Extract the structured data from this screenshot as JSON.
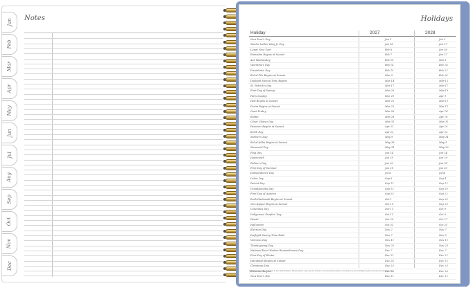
{
  "notes_page": {
    "title": "Notes",
    "month_tabs": [
      "Jan",
      "Feb",
      "Mar",
      "Apr",
      "May",
      "Jun",
      "Jul",
      "Aug",
      "Sep",
      "Oct",
      "Nov",
      "Dec"
    ]
  },
  "holidays_page": {
    "title": "Holidays",
    "columns": [
      "Holiday",
      "2027",
      "2028"
    ],
    "rows": [
      [
        "New Year's Day",
        "Jan 1",
        "Jan 1"
      ],
      [
        "Martin Luther King Jr. Day",
        "Jan 18",
        "Jan 17"
      ],
      [
        "Lunar New Year",
        "Feb 6",
        "Jan 26"
      ],
      [
        "Ramadan Begins at Sunset",
        "Feb 7",
        "Jan 27"
      ],
      [
        "Ash Wednesday",
        "Feb 10",
        "Mar 1"
      ],
      [
        "Valentine's Day",
        "Feb 14",
        "Feb 14"
      ],
      [
        "Presidents' Day",
        "Feb 15",
        "Feb 21"
      ],
      [
        "Eid al-Fitr Begins at Sunset",
        "Mar 9",
        "Feb 26"
      ],
      [
        "Daylight Saving Time Begins",
        "Mar 14",
        "Mar 12"
      ],
      [
        "St. Patrick's Day",
        "Mar 17",
        "Mar 17"
      ],
      [
        "First Day of Spring",
        "Mar 20",
        "Mar 19"
      ],
      [
        "Palm Sunday",
        "Mar 21",
        "Apr 9"
      ],
      [
        "Holi Begins at Sunset",
        "Mar 22",
        "Mar 11"
      ],
      [
        "Purim Begins at Sunset",
        "Mar 22",
        "Mar 11"
      ],
      [
        "Good Friday",
        "Mar 26",
        "Apr 14"
      ],
      [
        "Easter",
        "Mar 28",
        "Apr 16"
      ],
      [
        "César Chávez Day",
        "Mar 31",
        "Mar 31"
      ],
      [
        "Passover Begins at Sunset",
        "Apr 21",
        "Apr 10"
      ],
      [
        "Earth Day",
        "Apr 22",
        "Apr 22"
      ],
      [
        "Mother's Day",
        "May 9",
        "May 14"
      ],
      [
        "Eid al-Adha Begins at Sunset",
        "May 16",
        "May 5"
      ],
      [
        "Memorial Day",
        "May 31",
        "May 29"
      ],
      [
        "Flag Day",
        "Jun 14",
        "Jun 14"
      ],
      [
        "Juneteenth",
        "Jun 19",
        "Jun 19"
      ],
      [
        "Father's Day",
        "Jun 20",
        "Jun 18"
      ],
      [
        "First Day of Summer",
        "Jun 21",
        "Jun 20"
      ],
      [
        "Independence Day",
        "Jul 4",
        "Jul 4"
      ],
      [
        "Labor Day",
        "Sep 6",
        "Sep 4"
      ],
      [
        "Patriot Day",
        "Sep 11",
        "Sep 11"
      ],
      [
        "Grandparents Day",
        "Sep 12",
        "Sep 10"
      ],
      [
        "First Day of Autumn",
        "Sep 23",
        "Sep 22"
      ],
      [
        "Rosh Hashanah Begins at Sunset",
        "Oct 1",
        "Sep 20"
      ],
      [
        "Yom Kippur Begins at Sunset",
        "Oct 10",
        "Sep 29"
      ],
      [
        "Columbus Day",
        "Oct 11",
        "Oct 9"
      ],
      [
        "Indigenous Peoples' Day",
        "Oct 11",
        "Oct 9"
      ],
      [
        "Diwali",
        "Oct 29",
        "Oct 17"
      ],
      [
        "Halloween",
        "Oct 31",
        "Oct 31"
      ],
      [
        "Election Day",
        "Nov 2",
        "Nov 7"
      ],
      [
        "Daylight Saving Time Ends",
        "Nov 7",
        "Nov 5"
      ],
      [
        "Veterans Day",
        "Nov 11",
        "Nov 11"
      ],
      [
        "Thanksgiving Day",
        "Nov 25",
        "Nov 23"
      ],
      [
        "National Pearl Harbor Remembrance Day",
        "Dec 7",
        "Dec 7"
      ],
      [
        "First Day of Winter",
        "Dec 21",
        "Dec 21"
      ],
      [
        "Hanukkah Begins at Sunset",
        "Dec 24",
        "Dec 12"
      ],
      [
        "Christmas Day",
        "Dec 25",
        "Dec 25"
      ],
      [
        "Kwanzaa Begins",
        "Dec 26",
        "Dec 26"
      ],
      [
        "New Year's Eve",
        "Dec 31",
        "Dec 31"
      ]
    ],
    "footnote": "Holidays listed are observed in the United States. Observances may vary by location. Sunset dates based on local time; some holidays begin at sunset the previous day."
  },
  "colors": {
    "cover": "#7f95c2",
    "spiral_wire": "#c9a24b"
  }
}
